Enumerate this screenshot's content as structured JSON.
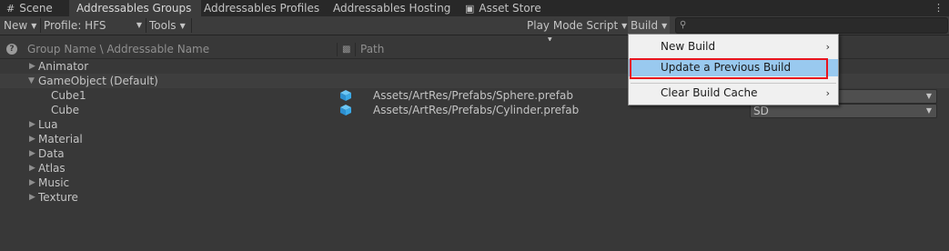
{
  "tabs": [
    {
      "label": "Scene",
      "icon": "grid-icon"
    },
    {
      "label": "Addressables Groups"
    },
    {
      "label": "Addressables Profiles"
    },
    {
      "label": "Addressables Hosting"
    },
    {
      "label": "Asset Store",
      "icon": "bag-icon"
    }
  ],
  "toolbar": {
    "new_label": "New",
    "profile_label": "Profile: HFS",
    "tools_label": "Tools",
    "play_mode_label": "Play Mode Script",
    "build_label": "Build",
    "search_value": ""
  },
  "columns": {
    "name": "Group Name \\ Addressable Name",
    "path": "Path"
  },
  "tree": [
    {
      "label": "Animator",
      "expanded": false
    },
    {
      "label": "GameObject (Default)",
      "expanded": true,
      "children": [
        {
          "label": "Cube1",
          "path": "Assets/ArtRes/Prefabs/Sphere.prefab",
          "label_value": ""
        },
        {
          "label": "Cube",
          "path": "Assets/ArtRes/Prefabs/Cylinder.prefab",
          "label_value": "SD"
        }
      ]
    },
    {
      "label": "Lua",
      "expanded": false
    },
    {
      "label": "Material",
      "expanded": false
    },
    {
      "label": "Data",
      "expanded": false
    },
    {
      "label": "Atlas",
      "expanded": false
    },
    {
      "label": "Music",
      "expanded": false
    },
    {
      "label": "Texture",
      "expanded": false
    }
  ],
  "build_menu": [
    {
      "label": "New Build",
      "has_submenu": true
    },
    {
      "label": "Update a Previous Build",
      "has_submenu": false,
      "highlighted": true
    },
    {
      "label": "Clear Build Cache",
      "has_submenu": true
    }
  ],
  "colors": {
    "background": "#383838",
    "menu_highlight": "#99c9ef",
    "annotation_box": "#e8141e",
    "prefab_icon": "#3aa8e6"
  }
}
